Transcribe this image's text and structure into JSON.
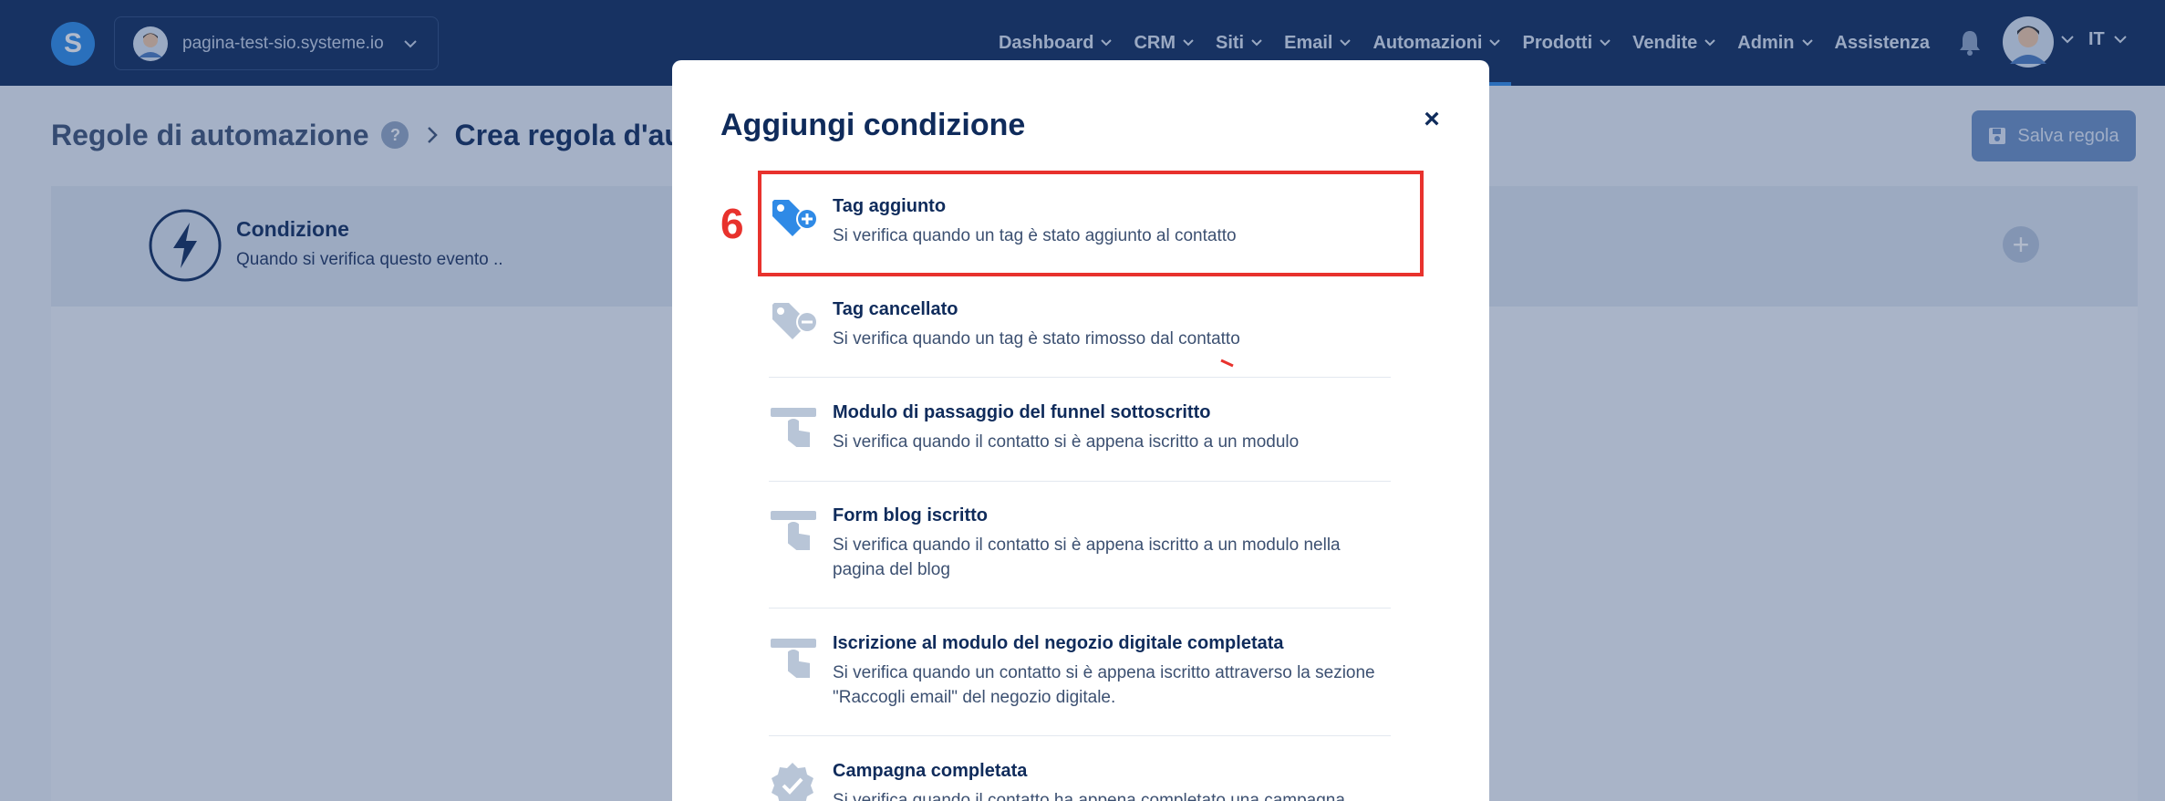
{
  "topbar": {
    "logo_letter": "S",
    "site_name": "pagina-test-sio.systeme.io",
    "nav": [
      {
        "label": "Dashboard"
      },
      {
        "label": "CRM"
      },
      {
        "label": "Siti"
      },
      {
        "label": "Email"
      },
      {
        "label": "Automazioni"
      },
      {
        "label": "Prodotti"
      },
      {
        "label": "Vendite"
      },
      {
        "label": "Admin"
      },
      {
        "label": "Assistenza"
      }
    ],
    "active_nav": "Automazioni",
    "language": "IT",
    "icons": {
      "bell": "bell-icon",
      "avatar": "user-avatar"
    }
  },
  "page": {
    "breadcrumb_root": "Regole di automazione",
    "help_symbol": "?",
    "breadcrumb_current": "Crea regola d'autom",
    "save_button": "Salva regola",
    "condition_title": "Condizione",
    "condition_desc": "Quando si verifica questo evento ..",
    "add_symbol": "+"
  },
  "modal": {
    "title": "Aggiungi condizione",
    "close_symbol": "×",
    "step_number": "6",
    "options": [
      {
        "title": "Tag aggiunto",
        "desc": "Si verifica quando un tag è stato aggiunto al contatto",
        "icon": "tag-plus-icon",
        "selected": true
      },
      {
        "title": "Tag cancellato",
        "desc": "Si verifica quando un tag è stato rimosso dal contatto",
        "icon": "tag-minus-icon"
      },
      {
        "title": "Modulo di passaggio del funnel sottoscritto",
        "desc": "Si verifica quando il contatto si è appena iscritto a un modulo",
        "icon": "form-pointer-icon"
      },
      {
        "title": "Form blog iscritto",
        "desc": "Si verifica quando il contatto si è appena iscritto a un modulo nella pagina del blog",
        "icon": "form-pointer-icon"
      },
      {
        "title": "Iscrizione al modulo del negozio digitale completata",
        "desc": "Si verifica quando un contatto si è appena iscritto attraverso la sezione \"Raccogli email\" del negozio digitale.",
        "icon": "form-pointer-icon"
      },
      {
        "title": "Campagna completata",
        "desc": "Si verifica quando il contatto ha appena completato una campagna",
        "icon": "badge-check-icon"
      }
    ]
  },
  "colors": {
    "nav_bg": "#0f2b5b",
    "accent": "#2f8ae6",
    "highlight": "#e8322d",
    "icon_muted": "#b8c5d7",
    "icon_active": "#2f8ae6"
  }
}
